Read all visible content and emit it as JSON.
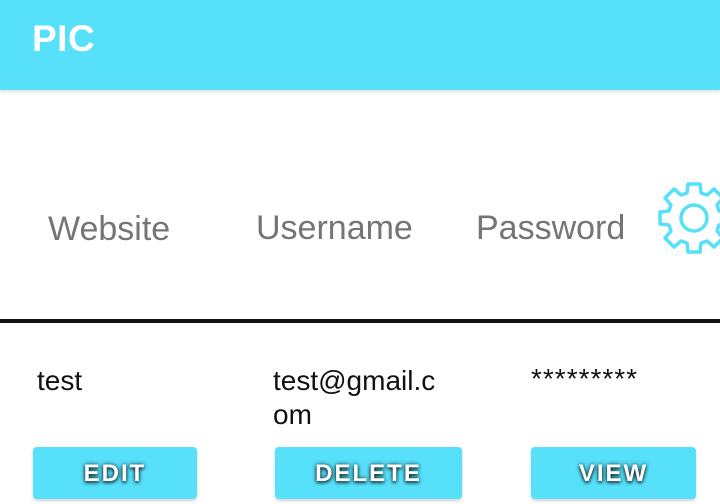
{
  "app_bar": {
    "title": "PIC",
    "color": "#56e0fa"
  },
  "table": {
    "headers": {
      "website": "Website",
      "username": "Username",
      "password": "Password"
    },
    "settings_icon": "gear-icon",
    "rows": [
      {
        "website": "test",
        "username": "test@gmail.com",
        "password": "*********",
        "actions": {
          "edit": "EDIT",
          "delete": "DELETE",
          "view": "VIEW"
        }
      }
    ]
  }
}
